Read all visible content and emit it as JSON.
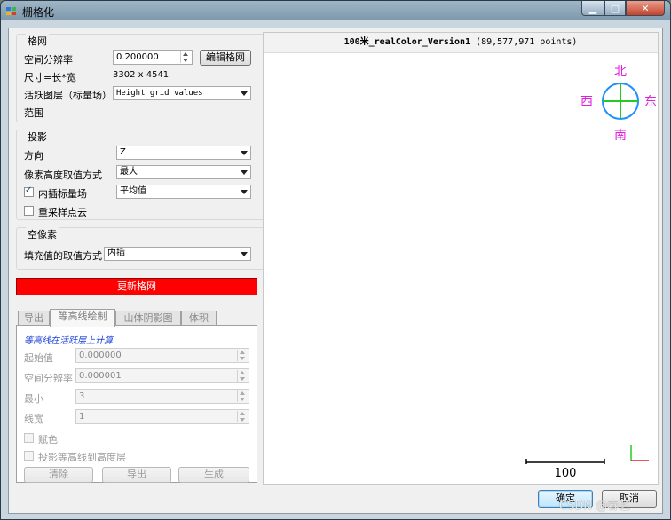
{
  "window": {
    "title": "栅格化"
  },
  "grid": {
    "title": "格网",
    "resolution_label": "空间分辨率",
    "resolution_value": "0.200000",
    "edit_button": "编辑格网",
    "size_label": "尺寸=长*宽",
    "size_value": "3302 x 4541",
    "active_layer_label": "活跃图层（标量场）",
    "active_layer_value": "Height grid values",
    "range_label": "范围"
  },
  "projection": {
    "title": "投影",
    "direction_label": "方向",
    "direction_value": "Z",
    "cell_height_label": "像素高度取值方式",
    "cell_height_value": "最大",
    "interpolate_label": "内插标量场",
    "interpolate_checked": true,
    "interpolate_value": "平均值",
    "resample_label": "重采样点云",
    "resample_checked": false
  },
  "empty_cells": {
    "title": "空像素",
    "fill_label": "填充值的取值方式",
    "fill_value": "内插"
  },
  "update_button": "更新格网",
  "tabs": [
    {
      "label": "导出",
      "active": false
    },
    {
      "label": "等高线绘制",
      "active": true
    },
    {
      "label": "山体阴影图",
      "active": false
    },
    {
      "label": "体积",
      "active": false
    }
  ],
  "contour": {
    "note": "等高线在活跃层上计算",
    "start_label": "起始值",
    "start_value": "0.000000",
    "step_label": "空间分辨率",
    "step_value": "0.000001",
    "min_label": "最小",
    "min_value": "3",
    "width_label": "线宽",
    "width_value": "1",
    "colorize_label": "赋色",
    "project_label": "投影等高线到高度层",
    "clear_button": "清除",
    "export_button": "导出",
    "generate_button": "生成"
  },
  "viewer": {
    "cloud_name": "100米_realColor_Version1",
    "point_count": "(89,577,971 points)",
    "compass": {
      "north": "北",
      "south": "南",
      "west": "西",
      "east": "东"
    },
    "scale_label": "100",
    "colors": {
      "compass_text": "#e01ee0",
      "compass_ring": "#1e90ff",
      "compass_cross": "#22cc22"
    }
  },
  "footer": {
    "ok_button": "确定",
    "cancel_button": "取消",
    "watermark": "CSDN @春艺"
  }
}
